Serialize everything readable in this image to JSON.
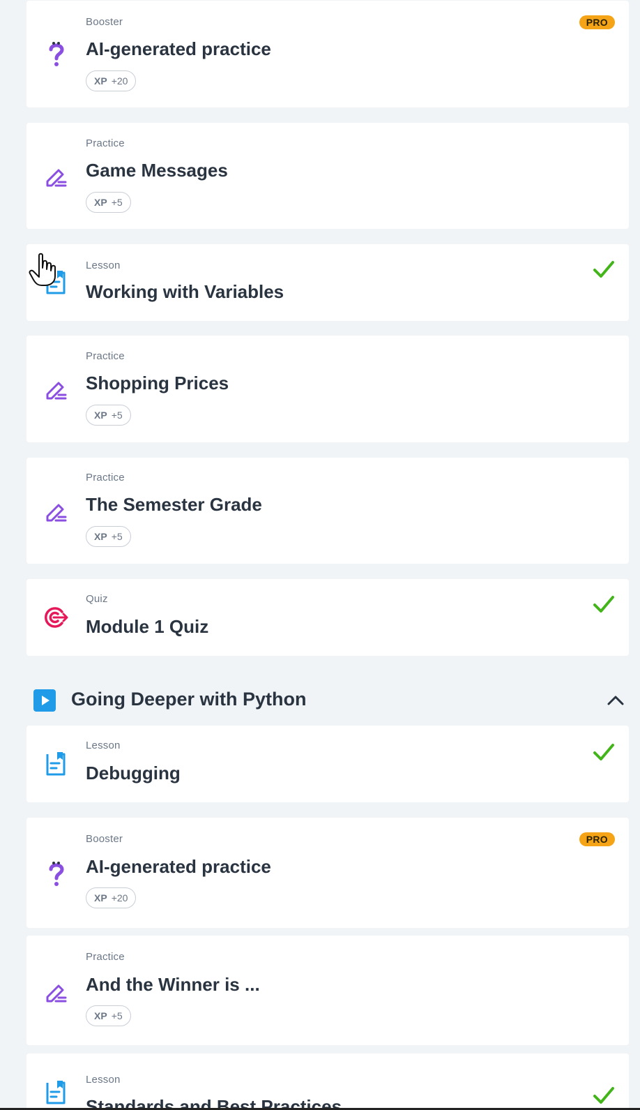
{
  "colors": {
    "background": "#f1f4f7",
    "card": "#ffffff",
    "practice_icon": "#8a4fe0",
    "lesson_icon": "#1f9be8",
    "quiz_icon": "#e5195a",
    "check": "#43b51a",
    "pro_badge": "#f6a417"
  },
  "items": [
    {
      "type": "Booster",
      "title": "AI-generated practice",
      "xp_label": "XP",
      "xp_value": "+20",
      "badge": "PRO",
      "icon": "booster-question-icon"
    },
    {
      "type": "Practice",
      "title": "Game Messages",
      "xp_label": "XP",
      "xp_value": "+5",
      "icon": "pencil-icon"
    },
    {
      "type": "Lesson",
      "title": "Working with Variables",
      "completed": true,
      "icon": "lesson-document-icon"
    },
    {
      "type": "Practice",
      "title": "Shopping Prices",
      "xp_label": "XP",
      "xp_value": "+5",
      "icon": "pencil-icon"
    },
    {
      "type": "Practice",
      "title": "The Semester Grade",
      "xp_label": "XP",
      "xp_value": "+5",
      "icon": "pencil-icon"
    },
    {
      "type": "Quiz",
      "title": "Module 1 Quiz",
      "completed": true,
      "icon": "target-icon"
    },
    {
      "type": "Lesson",
      "title": "Debugging",
      "completed": true,
      "icon": "lesson-document-icon"
    },
    {
      "type": "Booster",
      "title": "AI-generated practice",
      "xp_label": "XP",
      "xp_value": "+20",
      "badge": "PRO",
      "icon": "booster-question-icon"
    },
    {
      "type": "Practice",
      "title": "And the Winner is ...",
      "xp_label": "XP",
      "xp_value": "+5",
      "icon": "pencil-icon"
    },
    {
      "type": "Lesson",
      "title": "Standards and Best Practices",
      "completed": true,
      "icon": "lesson-document-icon"
    }
  ],
  "section": {
    "title": "Going Deeper with Python",
    "icon": "play-icon",
    "toggle_icon": "chevron-up-icon"
  }
}
